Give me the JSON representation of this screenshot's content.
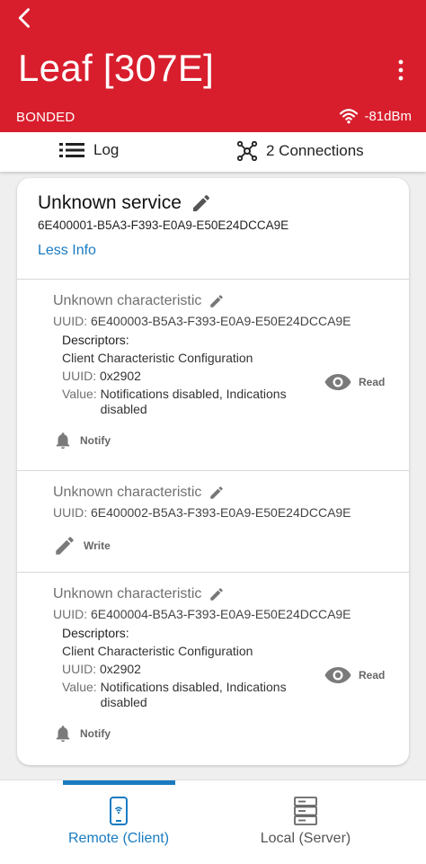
{
  "appbar": {
    "title": "Leaf [307E]",
    "status": "BONDED",
    "rssi": "-81dBm",
    "color": "#d81e2d"
  },
  "tabs": {
    "log_label": "Log",
    "connections_label": "2 Connections"
  },
  "service": {
    "name": "Unknown service",
    "uuid": "6E400001-B5A3-F393-E0A9-E50E24DCCA9E",
    "toggle_label": "Less Info"
  },
  "characteristics": [
    {
      "name": "Unknown characteristic",
      "uuid_label": "UUID:",
      "uuid": "6E400003-B5A3-F393-E0A9-E50E24DCCA9E",
      "descriptors_title": "Descriptors:",
      "descriptor_name": "Client Characteristic Configuration",
      "descriptor_uuid_label": "UUID:",
      "descriptor_uuid": "0x2902",
      "value_label": "Value:",
      "value": "Notifications disabled, Indications disabled",
      "read_label": "Read",
      "notify_label": "Notify"
    },
    {
      "name": "Unknown characteristic",
      "uuid_label": "UUID:",
      "uuid": "6E400002-B5A3-F393-E0A9-E50E24DCCA9E",
      "write_label": "Write"
    },
    {
      "name": "Unknown characteristic",
      "uuid_label": "UUID:",
      "uuid": "6E400004-B5A3-F393-E0A9-E50E24DCCA9E",
      "descriptors_title": "Descriptors:",
      "descriptor_name": "Client Characteristic Configuration",
      "descriptor_uuid_label": "UUID:",
      "descriptor_uuid": "0x2902",
      "value_label": "Value:",
      "value": "Notifications disabled, Indications disabled",
      "read_label": "Read",
      "notify_label": "Notify"
    }
  ],
  "bottom_nav": {
    "remote_label": "Remote (Client)",
    "local_label": "Local (Server)",
    "active_color": "#1a7bc1"
  }
}
